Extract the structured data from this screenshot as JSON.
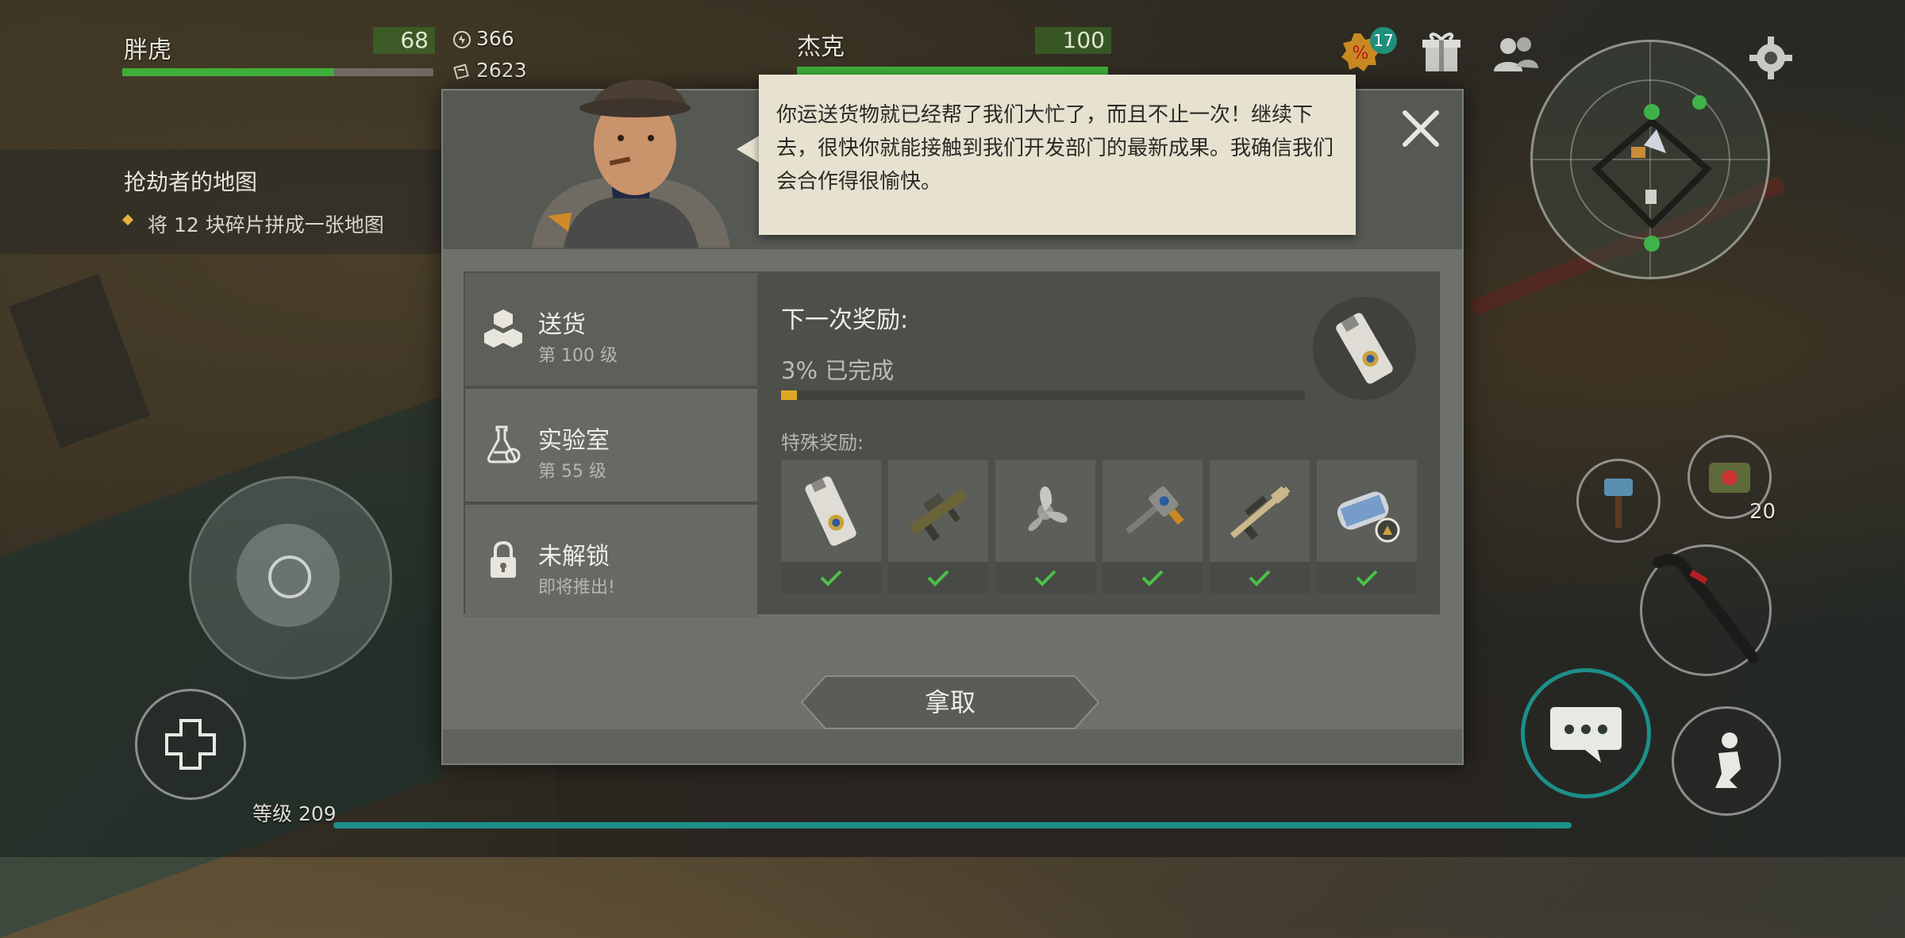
{
  "hud": {
    "player_name": "胖虎",
    "player_hp": "68",
    "player_hp_fraction": 0.68,
    "res_energy": "366",
    "res_coins": "2623",
    "npc_name": "杰克",
    "npc_hp": "100",
    "npc_hp_fraction": 1.0,
    "discount_badge": "17",
    "level_label": "等级 209",
    "item_count": "20"
  },
  "quest": {
    "title": "抢劫者的地图",
    "desc": "将 12 块碎片拼成一张地图"
  },
  "modal": {
    "speech": "你运送货物就已经帮了我们大忙了，而且不止一次！继续下去，很快你就能接触到我们开发部门的最新成果。我确信我们会合作得很愉快。",
    "tabs": [
      {
        "title": "送货",
        "sub": "第 100 级"
      },
      {
        "title": "实验室",
        "sub": "第 55 级"
      },
      {
        "title": "未解锁",
        "sub": "即将推出!"
      }
    ],
    "next_reward_label": "下一次奖励:",
    "progress_text": "3% 已完成",
    "progress_fraction": 0.03,
    "special_label": "特殊奖励:",
    "rewards": [
      {
        "icon": "keycard-icon"
      },
      {
        "icon": "grenade-launcher-icon"
      },
      {
        "icon": "propeller-icon"
      },
      {
        "icon": "drill-icon"
      },
      {
        "icon": "sniper-rifle-icon"
      },
      {
        "icon": "blueprint-icon"
      }
    ],
    "take_label": "拿取"
  },
  "colors": {
    "hp_green": "#3fae3a",
    "progress_gold": "#e0a824",
    "speech_bg": "#e6e2cf",
    "xp_teal": "#1c8f8a"
  }
}
